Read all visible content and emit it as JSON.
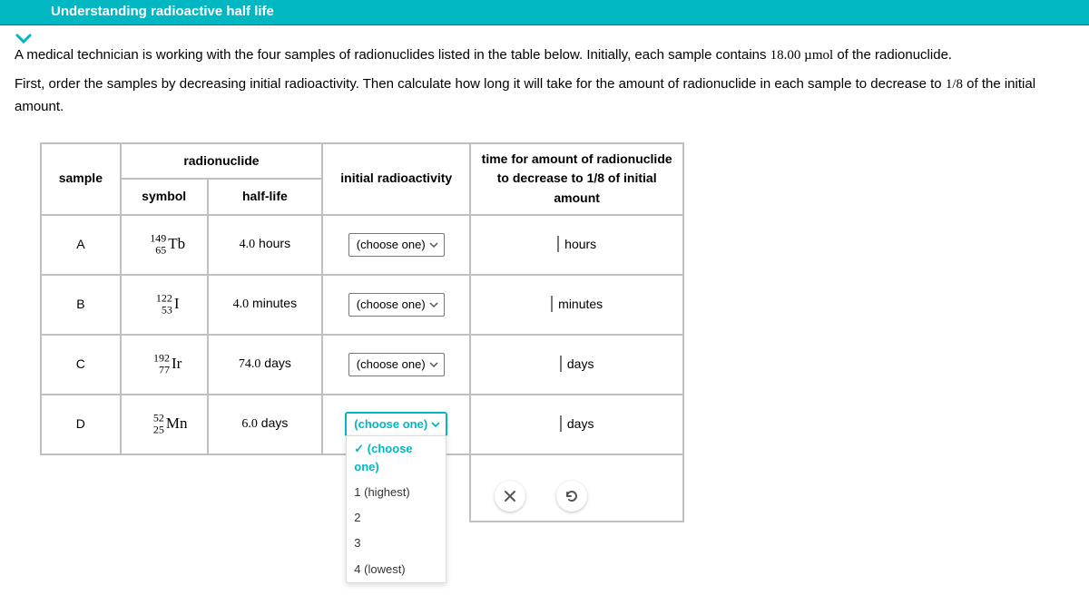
{
  "header": {
    "title": "Understanding radioactive half life"
  },
  "intro": {
    "line1_prefix": "A medical technician is working with the four samples of radionuclides listed in the table below. Initially, each sample contains ",
    "amount": "18.00 µmol",
    "line1_suffix": " of the radionuclide.",
    "line2_prefix": "First, order the samples by decreasing initial radioactivity. Then calculate how long it will take for the amount of radionuclide in each sample to decrease to ",
    "fraction": "1/8",
    "line2_suffix": " of the initial amount."
  },
  "table": {
    "headers": {
      "sample": "sample",
      "radionuclide": "radionuclide",
      "symbol": "symbol",
      "halflife": "half-life",
      "radioactivity": "initial radioactivity",
      "time": "time for amount of radionuclide to decrease to 1/8 of initial amount"
    },
    "choose_label": "(choose one)",
    "dropdown_options": [
      "(choose one)",
      "1 (highest)",
      "2",
      "3",
      "4 (lowest)"
    ],
    "rows": [
      {
        "sample": "A",
        "mass": "149",
        "atomic": "65",
        "element": "Tb",
        "half_val": "4.0",
        "half_unit": "hours",
        "time_unit": "hours"
      },
      {
        "sample": "B",
        "mass": "122",
        "atomic": "53",
        "element": "I",
        "half_val": "4.0",
        "half_unit": "minutes",
        "time_unit": "minutes"
      },
      {
        "sample": "C",
        "mass": "192",
        "atomic": "77",
        "element": "Ir",
        "half_val": "74.0",
        "half_unit": "days",
        "time_unit": "days"
      },
      {
        "sample": "D",
        "mass": "52",
        "atomic": "25",
        "element": "Mn",
        "half_val": "6.0",
        "half_unit": "days",
        "time_unit": "days"
      }
    ]
  }
}
